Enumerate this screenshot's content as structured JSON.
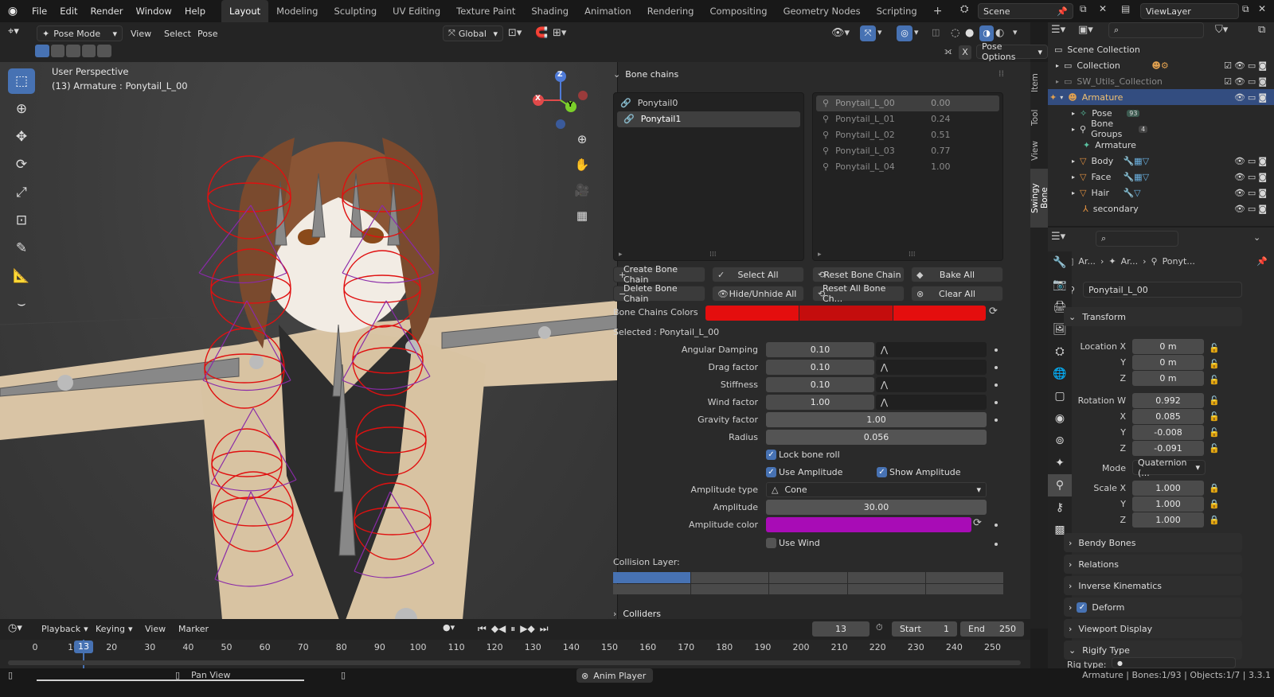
{
  "topbar": {
    "menus": [
      "File",
      "Edit",
      "Render",
      "Window",
      "Help"
    ],
    "workspaces": [
      "Layout",
      "Modeling",
      "Sculpting",
      "UV Editing",
      "Texture Paint",
      "Shading",
      "Animation",
      "Rendering",
      "Compositing",
      "Geometry Nodes",
      "Scripting"
    ],
    "active_workspace": "Layout",
    "scene": "Scene",
    "view_layer": "ViewLayer"
  },
  "viewport_header": {
    "mode": "Pose Mode",
    "menus": [
      "View",
      "Select",
      "Pose"
    ],
    "orientation": "Global",
    "pose_options": "Pose Options",
    "x_label": "X"
  },
  "viewport": {
    "perspective": "User Perspective",
    "object_info": "(13) Armature : Ponytail_L_00",
    "gizmo": {
      "z": "Z",
      "y": "Y",
      "x": "X"
    }
  },
  "side_tabs": [
    "Item",
    "Tool",
    "View",
    "Swingy Bone"
  ],
  "bone_panel": {
    "title": "Bone chains",
    "chains": [
      "Ponytail0",
      "Ponytail1"
    ],
    "selected_chain": "Ponytail1",
    "bones": [
      {
        "name": "Ponytail_L_00",
        "value": "0.00"
      },
      {
        "name": "Ponytail_L_01",
        "value": "0.24"
      },
      {
        "name": "Ponytail_L_02",
        "value": "0.51"
      },
      {
        "name": "Ponytail_L_03",
        "value": "0.77"
      },
      {
        "name": "Ponytail_L_04",
        "value": "1.00"
      }
    ],
    "buttons": {
      "create": "Create Bone Chain",
      "select_all": "Select All",
      "reset": "Reset Bone Chain",
      "bake": "Bake All",
      "delete": "Delete Bone Chain",
      "hide": "Hide/Unhide All",
      "reset_all": "Reset All Bone Ch...",
      "clear": "Clear All"
    },
    "colors_label": "Bone Chains Colors",
    "selected_label": "Selected : Ponytail_L_00",
    "angular_damping": {
      "label": "Angular Damping",
      "value": "0.10"
    },
    "drag_factor": {
      "label": "Drag factor",
      "value": "0.10"
    },
    "stiffness": {
      "label": "Stiffness",
      "value": "0.10"
    },
    "wind_factor": {
      "label": "Wind factor",
      "value": "1.00"
    },
    "gravity_factor": {
      "label": "Gravity factor",
      "value": "1.00"
    },
    "radius": {
      "label": "Radius",
      "value": "0.056"
    },
    "lock_bone_roll": "Lock bone roll",
    "use_amplitude": "Use Amplitude",
    "show_amplitude": "Show Amplitude",
    "amplitude_type": {
      "label": "Amplitude type",
      "value": "Cone"
    },
    "amplitude": {
      "label": "Amplitude",
      "value": "30.00"
    },
    "amplitude_color": {
      "label": "Amplitude color",
      "color": "#a80cb6"
    },
    "use_wind": "Use Wind",
    "collision_layer": "Collision Layer:",
    "colliders": "Colliders",
    "chain_colors": [
      "#e40e0e",
      "#c40d0d",
      "#e40e0e"
    ]
  },
  "outliner": {
    "scene_collection": "Scene Collection",
    "rows": [
      {
        "name": "Collection"
      },
      {
        "name": "SW_Utils_Collection"
      },
      {
        "name": "Armature"
      },
      {
        "name": "Pose",
        "badge": "93"
      },
      {
        "name": "Bone Groups",
        "badge": "4"
      },
      {
        "name": "Armature"
      },
      {
        "name": "Body"
      },
      {
        "name": "Face"
      },
      {
        "name": "Hair"
      },
      {
        "name": "secondary"
      }
    ]
  },
  "properties": {
    "breadcrumb": [
      "Ar...",
      "Ar...",
      "Ponyt..."
    ],
    "bone_name": "Ponytail_L_00",
    "transform_title": "Transform",
    "location": [
      {
        "label": "Location X",
        "value": "0 m"
      },
      {
        "label": "Y",
        "value": "0 m"
      },
      {
        "label": "Z",
        "value": "0 m"
      }
    ],
    "rotation": [
      {
        "label": "Rotation W",
        "value": "0.992"
      },
      {
        "label": "X",
        "value": "0.085"
      },
      {
        "label": "Y",
        "value": "-0.008"
      },
      {
        "label": "Z",
        "value": "-0.091"
      }
    ],
    "mode_label": "Mode",
    "mode_value": "Quaternion (...",
    "scale": [
      {
        "label": "Scale X",
        "value": "1.000"
      },
      {
        "label": "Y",
        "value": "1.000"
      },
      {
        "label": "Z",
        "value": "1.000"
      }
    ],
    "sections": [
      "Bendy Bones",
      "Relations",
      "Inverse Kinematics",
      "Deform",
      "Viewport Display",
      "Rigify Type"
    ],
    "rig_type_label": "Rig type:"
  },
  "timeline": {
    "menus": [
      "Playback",
      "Keying",
      "View",
      "Marker"
    ],
    "current_frame": "13",
    "start_label": "Start",
    "start": "1",
    "end_label": "End",
    "end": "250",
    "ticks": [
      "0",
      "10",
      "20",
      "30",
      "40",
      "50",
      "60",
      "70",
      "80",
      "90",
      "100",
      "110",
      "120",
      "130",
      "140",
      "150",
      "160",
      "170",
      "180",
      "190",
      "200",
      "210",
      "220",
      "230",
      "240",
      "250"
    ]
  },
  "status": {
    "pan": "Pan View",
    "anim": "Anim Player",
    "info": "Armature | Bones:1/93 | Objects:1/7 | 3.3.1"
  }
}
